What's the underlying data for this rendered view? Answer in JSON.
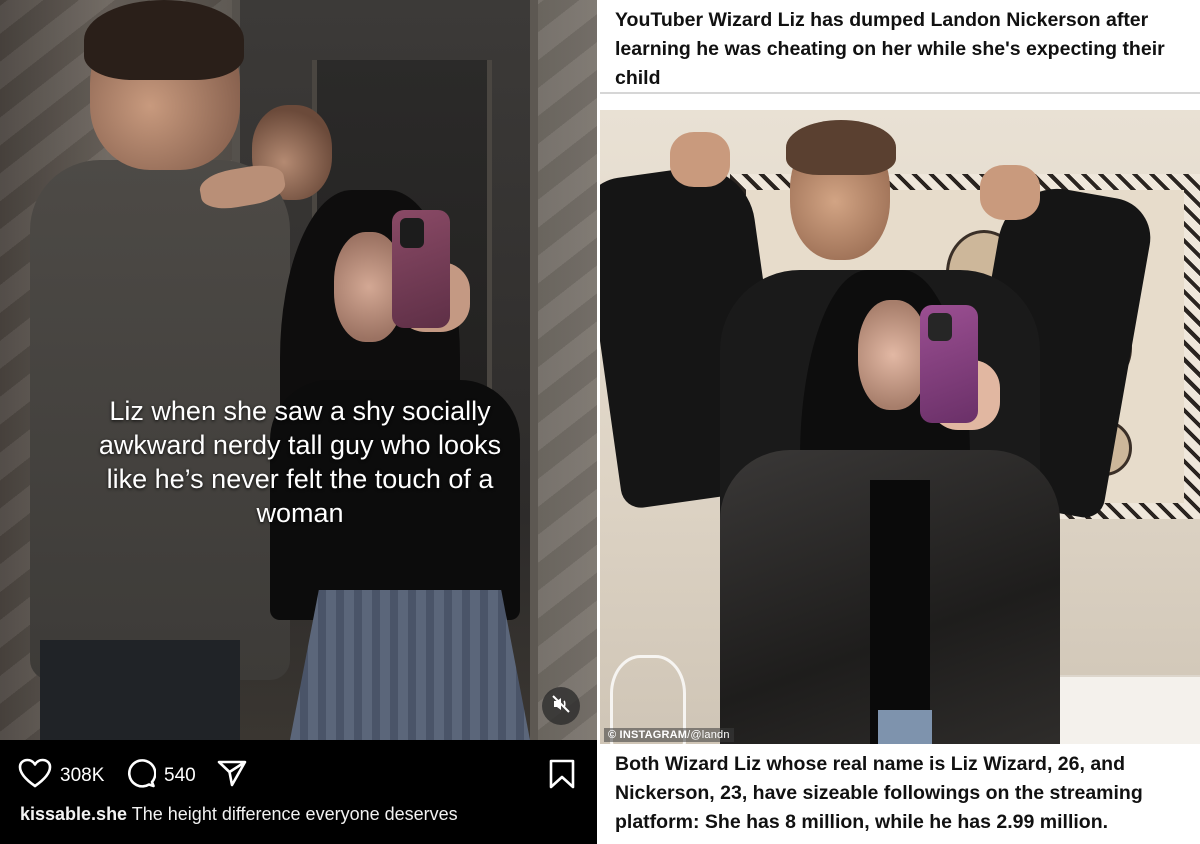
{
  "reel": {
    "overlay_text": "Liz when she saw a shy socially awkward nerdy tall guy who looks like he’s never felt the touch of a woman",
    "likes": "308K",
    "comments": "540",
    "username": "kissable.she",
    "caption": "The height difference everyone deserves",
    "icons": {
      "like": "heart-icon",
      "comment": "comment-icon",
      "share": "send-icon",
      "save": "bookmark-icon",
      "mute": "muted-speaker-icon"
    }
  },
  "article": {
    "headline": "YouTuber Wizard Liz has dumped Landon Nickerson after learning he was cheating on her while she's expecting their child",
    "photo_credit_source": "© INSTAGRAM",
    "photo_credit_handle": "/@landn",
    "body": "Both Wizard Liz whose real name is Liz Wizard, 26, and Nickerson, 23, have sizeable followings on the streaming platform: She has 8 million, while he has 2.99 million."
  },
  "colors": {
    "reel_background": "#000000",
    "reel_text": "#ffffff",
    "article_text": "#111111",
    "article_rule": "#d6d6d6"
  }
}
